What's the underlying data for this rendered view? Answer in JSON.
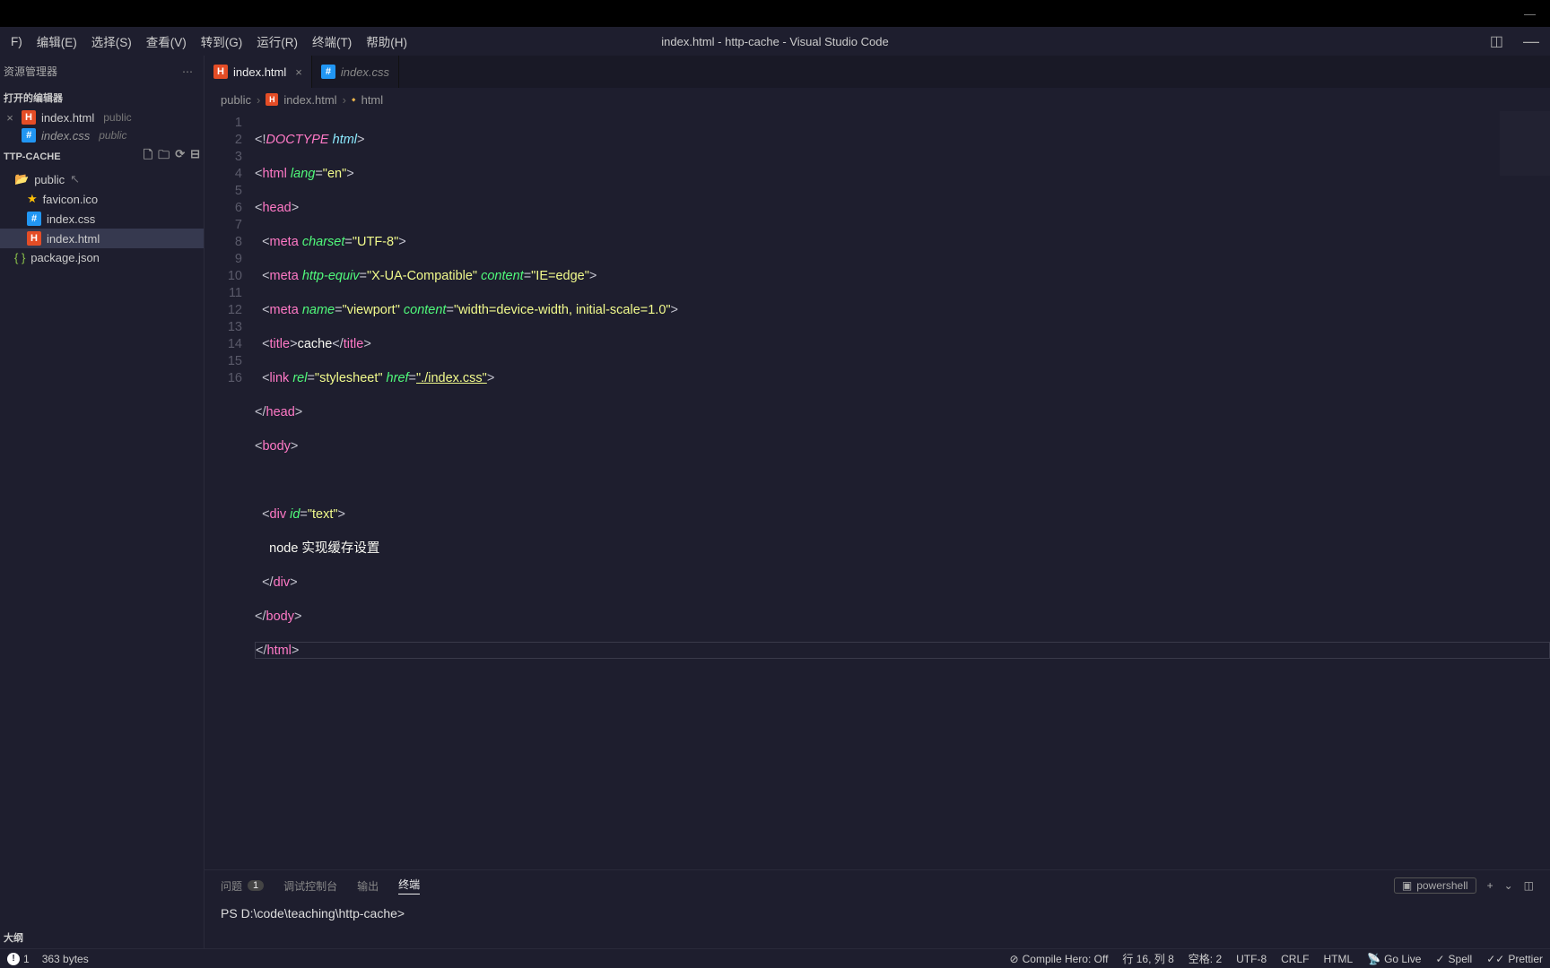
{
  "window": {
    "title": "index.html - http-cache - Visual Studio Code"
  },
  "menu": {
    "items": [
      "F)",
      "编辑(E)",
      "选择(S)",
      "查看(V)",
      "转到(G)",
      "运行(R)",
      "终端(T)",
      "帮助(H)"
    ]
  },
  "explorer": {
    "title": "资源管理器",
    "open_editors_label": "打开的编辑器",
    "open_editors": [
      {
        "name": "index.html",
        "path": "public",
        "active": true,
        "italic": false,
        "icon": "html"
      },
      {
        "name": "index.css",
        "path": "public",
        "active": false,
        "italic": true,
        "icon": "css"
      }
    ],
    "project": "TTP-CACHE",
    "tree": [
      {
        "name": "public",
        "type": "folder",
        "indent": 0
      },
      {
        "name": "favicon.ico",
        "type": "favicon",
        "indent": 1
      },
      {
        "name": "index.css",
        "type": "css",
        "indent": 1
      },
      {
        "name": "index.html",
        "type": "html",
        "indent": 1,
        "selected": true
      },
      {
        "name": "package.json",
        "type": "json",
        "indent": 0
      }
    ]
  },
  "tabs": [
    {
      "name": "index.html",
      "icon": "html",
      "active": true,
      "dirty": false
    },
    {
      "name": "index.css",
      "icon": "css",
      "active": false,
      "italic": true
    }
  ],
  "breadcrumbs": [
    "public",
    "index.html",
    "html"
  ],
  "editor": {
    "lines": 16,
    "code": {
      "l7_text": "cache",
      "l13_text": "node 实现缓存设置",
      "lang": "\"en\"",
      "charset": "\"UTF-8\"",
      "xua": "\"X-UA-Compatible\"",
      "ie": "\"IE=edge\"",
      "viewport": "\"viewport\"",
      "vpcontent": "\"width=device-width, initial-scale=1.0\"",
      "rel": "\"stylesheet\"",
      "href": "\"./index.css\"",
      "divid": "\"text\""
    }
  },
  "panel": {
    "tabs": {
      "problems": "问题",
      "problems_count": "1",
      "debug": "调试控制台",
      "output": "输出",
      "terminal": "终端"
    },
    "shell": "powershell",
    "prompt": "PS D:\\code\\teaching\\http-cache>"
  },
  "status": {
    "left": {
      "outline": "大纲",
      "warn": "1",
      "size": "363 bytes"
    },
    "right": {
      "compile": "Compile Hero: Off",
      "pos": "行 16, 列 8",
      "spaces": "空格: 2",
      "enc": "UTF-8",
      "eol": "CRLF",
      "lang": "HTML",
      "live": "Go Live",
      "spell": "Spell",
      "prettier": "Prettier"
    }
  }
}
